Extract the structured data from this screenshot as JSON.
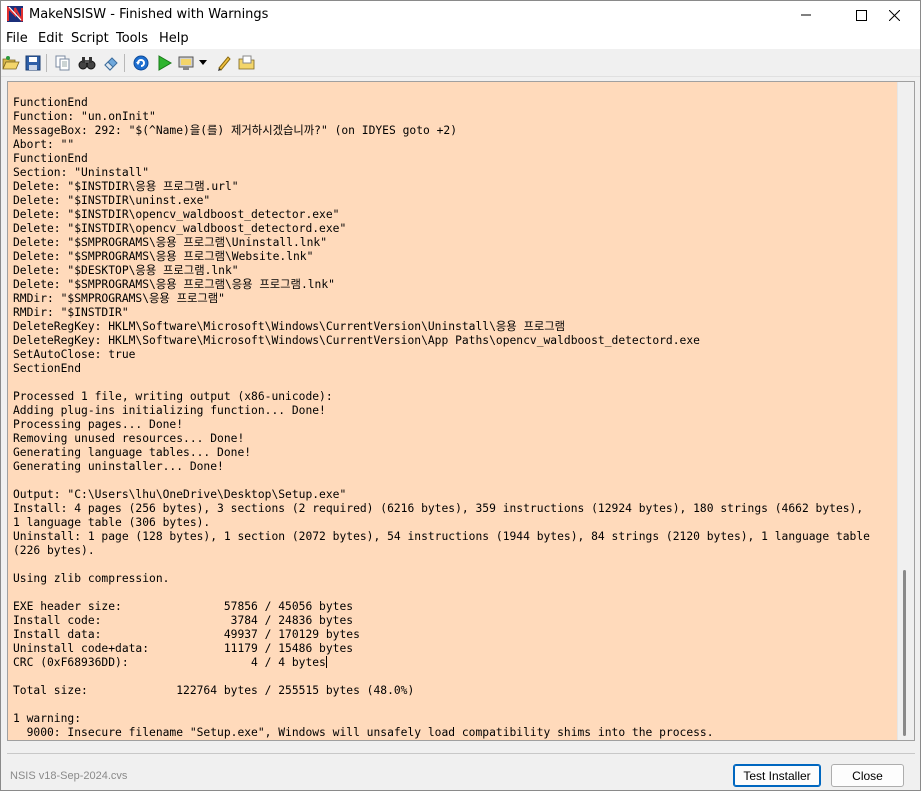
{
  "window": {
    "title": "MakeNSISW - Finished with Warnings"
  },
  "controls": {
    "minimize": "minimize",
    "maximize": "maximize",
    "close": "close"
  },
  "menu": [
    "File",
    "Edit",
    "Script",
    "Tools",
    "Help"
  ],
  "toolbar": {
    "icons": [
      "open-folder-icon",
      "save-icon",
      "copy-icon",
      "find-icon",
      "clear-icon",
      "recompile-icon",
      "test-icon",
      "compressor-icon",
      "dropdown-arrow-icon",
      "edit-script-icon",
      "browse-script-icon"
    ]
  },
  "log": {
    "lines": [
      "FunctionEnd",
      "Function: \"un.onInit\"",
      "MessageBox: 292: \"$(^Name)을(를) 제거하시겠습니까?\" (on IDYES goto +2)",
      "Abort: \"\"",
      "FunctionEnd",
      "Section: \"Uninstall\"",
      "Delete: \"$INSTDIR\\응용 프로그램.url\"",
      "Delete: \"$INSTDIR\\uninst.exe\"",
      "Delete: \"$INSTDIR\\opencv_waldboost_detector.exe\"",
      "Delete: \"$INSTDIR\\opencv_waldboost_detectord.exe\"",
      "Delete: \"$SMPROGRAMS\\응용 프로그램\\Uninstall.lnk\"",
      "Delete: \"$SMPROGRAMS\\응용 프로그램\\Website.lnk\"",
      "Delete: \"$DESKTOP\\응용 프로그램.lnk\"",
      "Delete: \"$SMPROGRAMS\\응용 프로그램\\응용 프로그램.lnk\"",
      "RMDir: \"$SMPROGRAMS\\응용 프로그램\"",
      "RMDir: \"$INSTDIR\"",
      "DeleteRegKey: HKLM\\Software\\Microsoft\\Windows\\CurrentVersion\\Uninstall\\응용 프로그램",
      "DeleteRegKey: HKLM\\Software\\Microsoft\\Windows\\CurrentVersion\\App Paths\\opencv_waldboost_detectord.exe",
      "SetAutoClose: true",
      "SectionEnd",
      "",
      "Processed 1 file, writing output (x86-unicode):",
      "Adding plug-ins initializing function... Done!",
      "Processing pages... Done!",
      "Removing unused resources... Done!",
      "Generating language tables... Done!",
      "Generating uninstaller... Done!",
      "",
      "Output: \"C:\\Users\\lhu\\OneDrive\\Desktop\\Setup.exe\"",
      "Install: 4 pages (256 bytes), 3 sections (2 required) (6216 bytes), 359 instructions (12924 bytes), 180 strings (4662 bytes),",
      "1 language table (306 bytes).",
      "Uninstall: 1 page (128 bytes), 1 section (2072 bytes), 54 instructions (1944 bytes), 84 strings (2120 bytes), 1 language table",
      "(226 bytes).",
      "",
      "Using zlib compression.",
      "",
      "EXE header size:               57856 / 45056 bytes",
      "Install code:                   3784 / 24836 bytes",
      "Install data:                  49937 / 170129 bytes",
      "Uninstall code+data:           11179 / 15486 bytes",
      "CRC (0xF68936DD):                  4 / 4 bytes",
      "",
      "Total size:             122764 bytes / 255515 bytes (48.0%)",
      "",
      "1 warning:",
      "  9000: Insecure filename \"Setup.exe\", Windows will unsafely load compatibility shims into the process."
    ]
  },
  "status": {
    "text": "NSIS v18-Sep-2024.cvs"
  },
  "buttons": {
    "test": "Test Installer",
    "close": "Close"
  }
}
